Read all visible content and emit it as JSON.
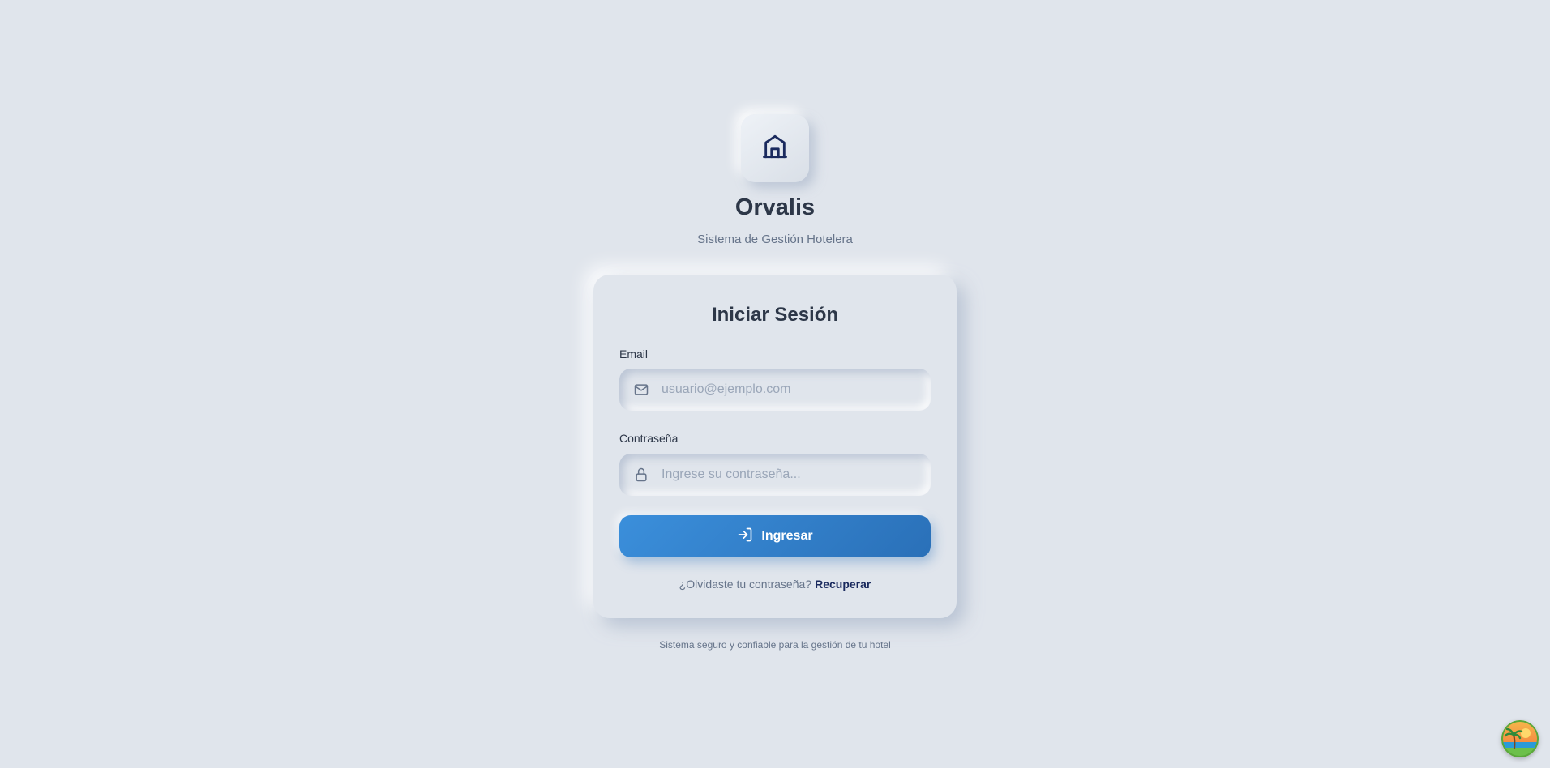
{
  "brand": {
    "name": "Orvalis",
    "subtitle": "Sistema de Gestión Hotelera",
    "logo_icon": "building-icon",
    "icon_color": "#1a2a5e"
  },
  "login": {
    "title": "Iniciar Sesión",
    "email": {
      "label": "Email",
      "placeholder": "usuario@ejemplo.com",
      "value": "",
      "icon": "mail-icon"
    },
    "password": {
      "label": "Contraseña",
      "placeholder": "Ingrese su contraseña...",
      "value": "",
      "icon": "lock-icon"
    },
    "submit": {
      "label": "Ingresar",
      "icon": "log-in-icon",
      "color": "#3186d1"
    },
    "forgot": {
      "text": "¿Olvidaste tu contraseña?",
      "link_label": "Recuperar"
    }
  },
  "footer": {
    "text": "Sistema seguro y confiable para la gestión de tu hotel"
  },
  "corner_widget": {
    "icon": "beach-avatar-icon"
  },
  "colors": {
    "background": "#e0e5ec",
    "heading": "#2d3748",
    "muted": "#66748a",
    "accent_link": "#1a2a5e"
  }
}
